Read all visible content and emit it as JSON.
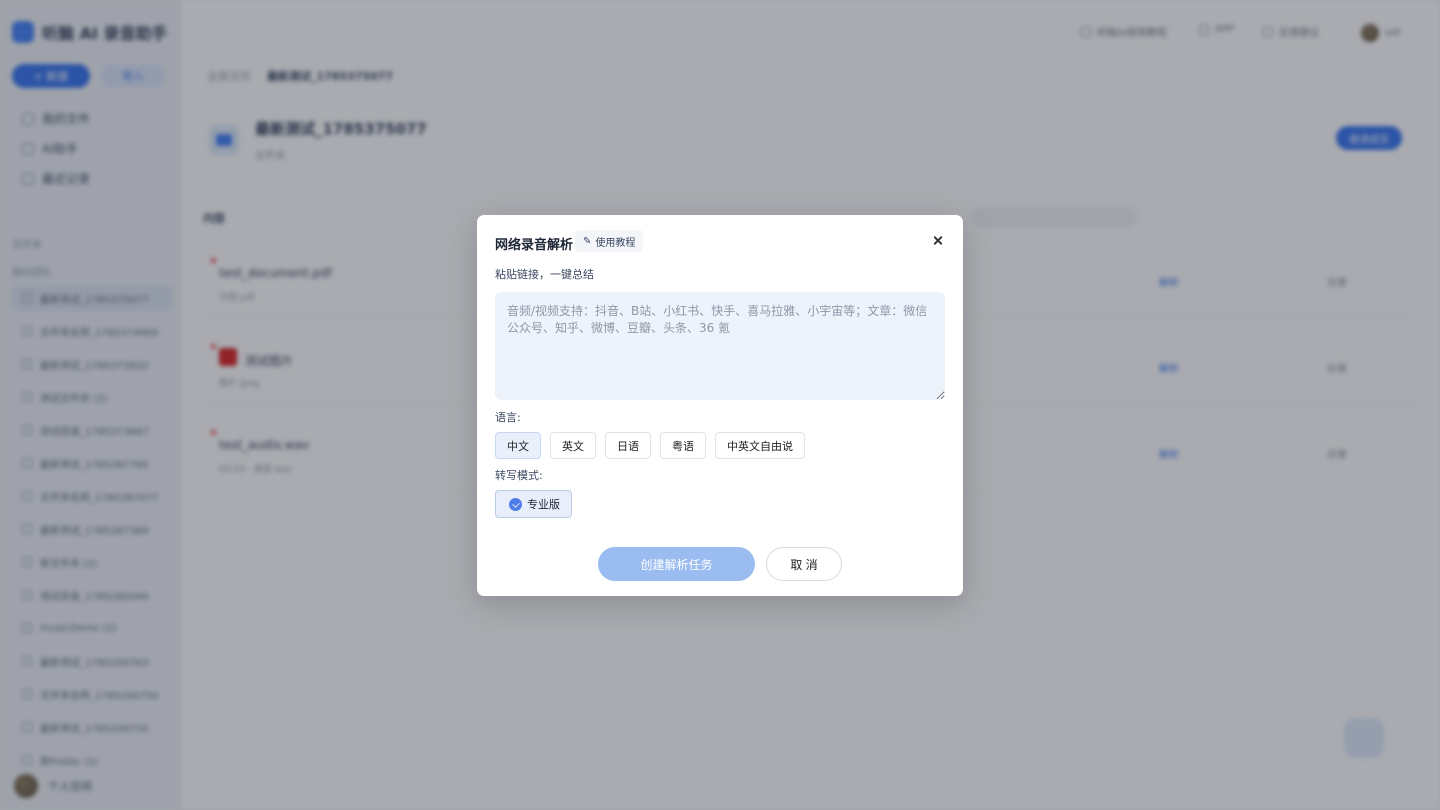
{
  "background": {
    "brand": {
      "name": "听脑 AI 录音助手"
    },
    "sidebar": {
      "new_label": "+ 新建",
      "import_label": "导入",
      "nav": [
        "我的文件",
        "AI助手",
        "最近记录"
      ],
      "section_label": "文件夹",
      "group_label": "我的团队",
      "folders": [
        "最新测试_1785375077",
        "文件夹名称_1785374965",
        "最新测试_1785373932",
        "测试文件夹 (2)",
        "测试目录_1785373687",
        "最新测试_1785287760",
        "文件夹名称_1785287477",
        "最新测试_1785287389",
        "新文件夹 (2)",
        "测试目录_1785285949",
        "musicDemo (2)",
        "最新测试_1785200763",
        "文件夹名称_1785200750",
        "最新测试_1785200720",
        "新Folder (1)"
      ],
      "user_name": "个人空间"
    },
    "topbar": [
      "听脑AI使用教程",
      "APP",
      "反馈建议",
      "VIP"
    ],
    "breadcrumb": {
      "root": "全部文件",
      "current": "最新测试_1785375077"
    },
    "folder": {
      "title": "最新测试_1785375077",
      "subtitle": "文件夹",
      "share_label": "邀请成员"
    },
    "list_label": "内容",
    "files": [
      {
        "name": "test_document.pdf",
        "meta": "文档 pdf",
        "action": "解析",
        "action2": "分享"
      },
      {
        "name": "测试图片",
        "meta": "图片 jpeg",
        "action": "解析",
        "action2": "分享"
      },
      {
        "name": "test_audio.wav",
        "meta": "00:03 · 录音 wav",
        "action": "解析",
        "action2": "分享"
      }
    ]
  },
  "modal": {
    "title": "网络录音解析",
    "tutorial_label": "使用教程",
    "subtitle": "粘贴链接，一键总结",
    "textarea_placeholder": "音频/视频支持：抖音、B站、小红书、快手、喜马拉雅、小宇宙等；文章：微信公众号、知乎、微博、豆瓣、头条、36 氪",
    "language_label": "语言:",
    "languages": [
      "中文",
      "英文",
      "日语",
      "粤语",
      "中英文自由说"
    ],
    "selected_language": "中文",
    "mode_label": "转写模式:",
    "mode_option": "专业版",
    "create_label": "创建解析任务",
    "cancel_label": "取 消"
  },
  "colors": {
    "accent": "#2f6ff0",
    "create_button_disabled": "#9bbcf1",
    "textarea_bg": "#eef2fb"
  },
  "icons": {
    "tutorial": "pencil-icon",
    "close": "close-icon",
    "mode": "verified-shield-icon"
  }
}
